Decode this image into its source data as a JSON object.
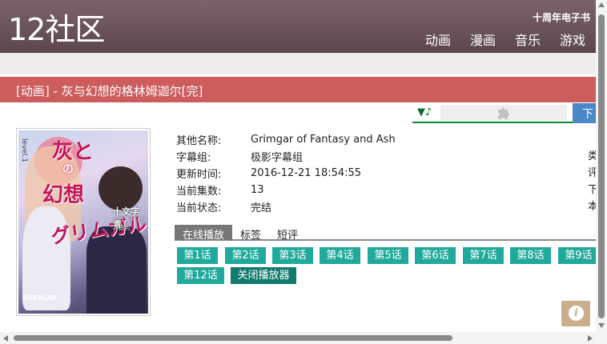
{
  "site": {
    "logo": "12社区",
    "promo": "十周年电子书",
    "nav": [
      "动画",
      "漫画",
      "音乐",
      "游戏"
    ]
  },
  "title_bar": "[动画] - 灰与幻想的格林姆迦尔[完]",
  "player": {
    "music_icon": "▼♪",
    "plugin_icon": "puzzle-icon",
    "download_tab": "下"
  },
  "cover": {
    "title_line1": "灰と",
    "title_line2": "の",
    "title_line3": "幻想",
    "title_line4": "グリムガル",
    "author": "十文字 青",
    "illustrator": "イラスト 白井鋭利",
    "volume": "level.1",
    "label": "OVERLAP"
  },
  "info": [
    {
      "label": "其他名称:",
      "value": "Grimgar of Fantasy and Ash",
      "right": "类"
    },
    {
      "label": "字幕组:",
      "value": "极影字幕组",
      "right": ""
    },
    {
      "label": "更新时间:",
      "value": "2016-12-21 18:54:55",
      "right": "评"
    },
    {
      "label": "当前集数:",
      "value": "13",
      "right": "下"
    },
    {
      "label": "当前状态:",
      "value": "完结",
      "right": "本"
    }
  ],
  "tabs": [
    "在线播放",
    "标签",
    "短评"
  ],
  "episodes": [
    "第1话",
    "第2话",
    "第3话",
    "第4话",
    "第5话",
    "第6话",
    "第7话",
    "第8话",
    "第9话",
    "第12话"
  ],
  "close_player": "关闭播放器",
  "fab_icon": "i",
  "colors": {
    "header": "#6b5359",
    "title_bar": "#cd5c5c",
    "episode": "#21a99c",
    "close": "#117a6c",
    "download": "#4a88c7"
  }
}
